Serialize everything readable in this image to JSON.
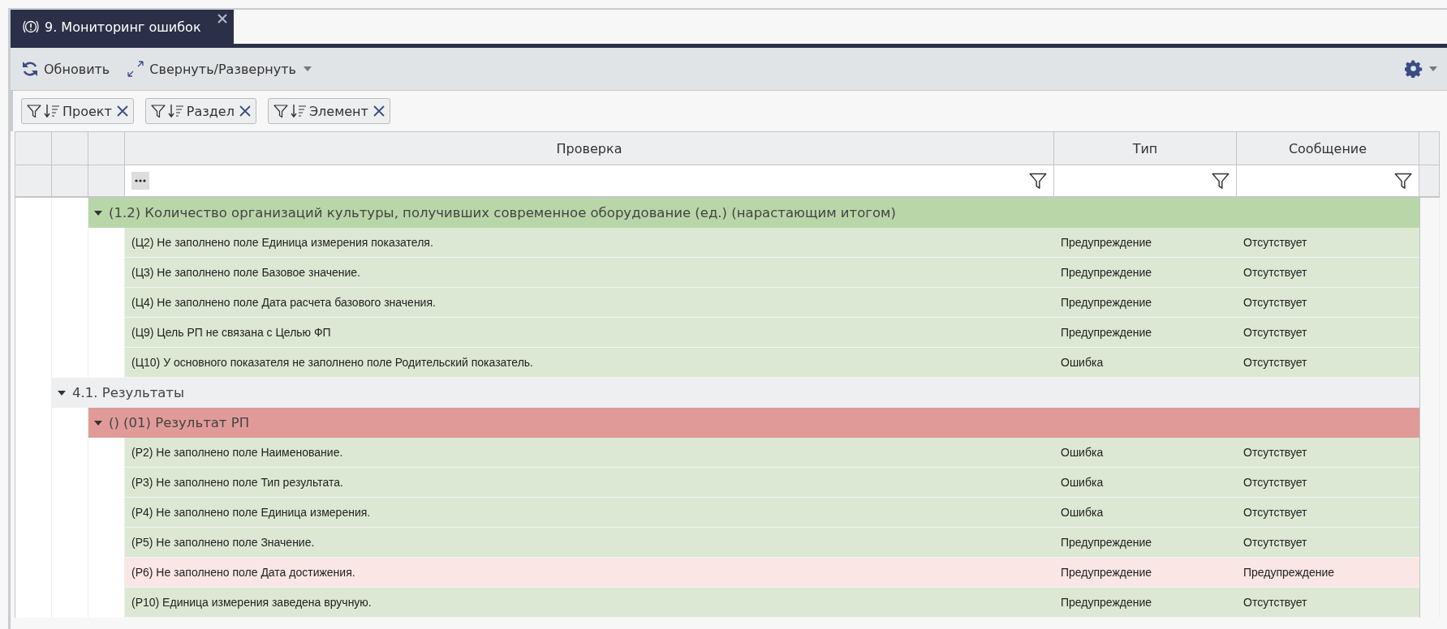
{
  "tab": {
    "title": "9. Мониторинг ошибок",
    "selected": true
  },
  "toolbar": {
    "buttons": [
      {
        "kind": "refresh",
        "label": "Обновить",
        "dropdown": false
      },
      {
        "kind": "expand",
        "label": "Свернуть/Развернуть",
        "dropdown": true
      }
    ],
    "settings": {
      "dropdown": true
    }
  },
  "filter_chips": [
    {
      "label": "Проект"
    },
    {
      "label": "Раздел"
    },
    {
      "label": "Элемент"
    }
  ],
  "table": {
    "columns": [
      {
        "title": "Проверка"
      },
      {
        "title": "Тип"
      },
      {
        "title": "Сообщение"
      }
    ],
    "rows": [
      {
        "kind": "group",
        "label": "(1.2) Количество организаций культуры, получивших современное оборудование (ед.) (нарастающим итогом)",
        "expanded": true,
        "color": "#b9d6a9",
        "children": [
          {
            "kind": "check",
            "check": "(Ц2) Не заполнено поле Единица измерения показателя.",
            "type": "Предупреждение",
            "message": "Отсутствует",
            "color": "#dce8d3"
          },
          {
            "kind": "check",
            "check": "(Ц3) Не заполнено поле Базовое значение.",
            "type": "Предупреждение",
            "message": "Отсутствует",
            "color": "#dce8d3"
          },
          {
            "kind": "check",
            "check": "(Ц4) Не заполнено поле Дата расчета базового значения.",
            "type": "Предупреждение",
            "message": "Отсутствует",
            "color": "#dce8d3"
          },
          {
            "kind": "check",
            "check": "(Ц9) Цель РП не связана с Целью ФП",
            "type": "Предупреждение",
            "message": "Отсутствует",
            "color": "#dce8d3"
          },
          {
            "kind": "check",
            "check": "(Ц10) У основного показателя не заполнено поле Родительский показатель.",
            "type": "Ошибка",
            "message": "Отсутствует",
            "color": "#dce8d3"
          }
        ]
      },
      {
        "kind": "section",
        "label": "4.1. Результаты",
        "expanded": true,
        "children": [
          {
            "kind": "group",
            "label": "() (01) Результат РП",
            "expanded": true,
            "color": "#e09b99",
            "children": [
              {
                "kind": "check",
                "check": "(Р2) Не заполнено поле Наименование.",
                "type": "Ошибка",
                "message": "Отсутствует",
                "color": "#dce8d3"
              },
              {
                "kind": "check",
                "check": "(Р3) Не заполнено поле Тип результата.",
                "type": "Ошибка",
                "message": "Отсутствует",
                "color": "#dce8d3"
              },
              {
                "kind": "check",
                "check": "(Р4) Не заполнено поле Единица измерения.",
                "type": "Ошибка",
                "message": "Отсутствует",
                "color": "#dce8d3"
              },
              {
                "kind": "check",
                "check": "(Р5) Не заполнено поле Значение.",
                "type": "Предупреждение",
                "message": "Отсутствует",
                "color": "#dce8d3"
              },
              {
                "kind": "check",
                "check": "(Р6) Не заполнено поле Дата достижения.",
                "type": "Предупреждение",
                "message": "Предупреждение",
                "color": "#fae6e5"
              },
              {
                "kind": "check",
                "check": "(Р10) Единица измерения заведена вручную.",
                "type": "Предупреждение",
                "message": "Отсутствует",
                "color": "#dce8d3"
              }
            ]
          }
        ]
      }
    ]
  }
}
